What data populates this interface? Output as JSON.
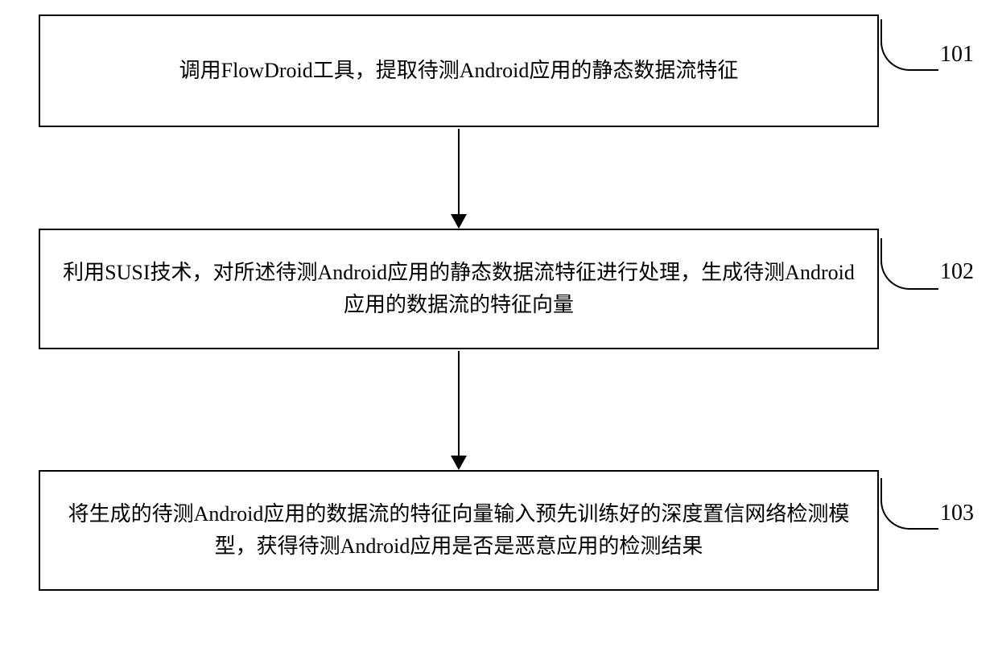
{
  "steps": [
    {
      "id": "101",
      "text": "调用FlowDroid工具，提取待测Android应用的静态数据流特征"
    },
    {
      "id": "102",
      "text": "利用SUSI技术，对所述待测Android应用的静态数据流特征进行处理，生成待测Android应用的数据流的特征向量"
    },
    {
      "id": "103",
      "text": "将生成的待测Android应用的数据流的特征向量输入预先训练好的深度置信网络检测模型，获得待测Android应用是否是恶意应用的检测结果"
    }
  ]
}
